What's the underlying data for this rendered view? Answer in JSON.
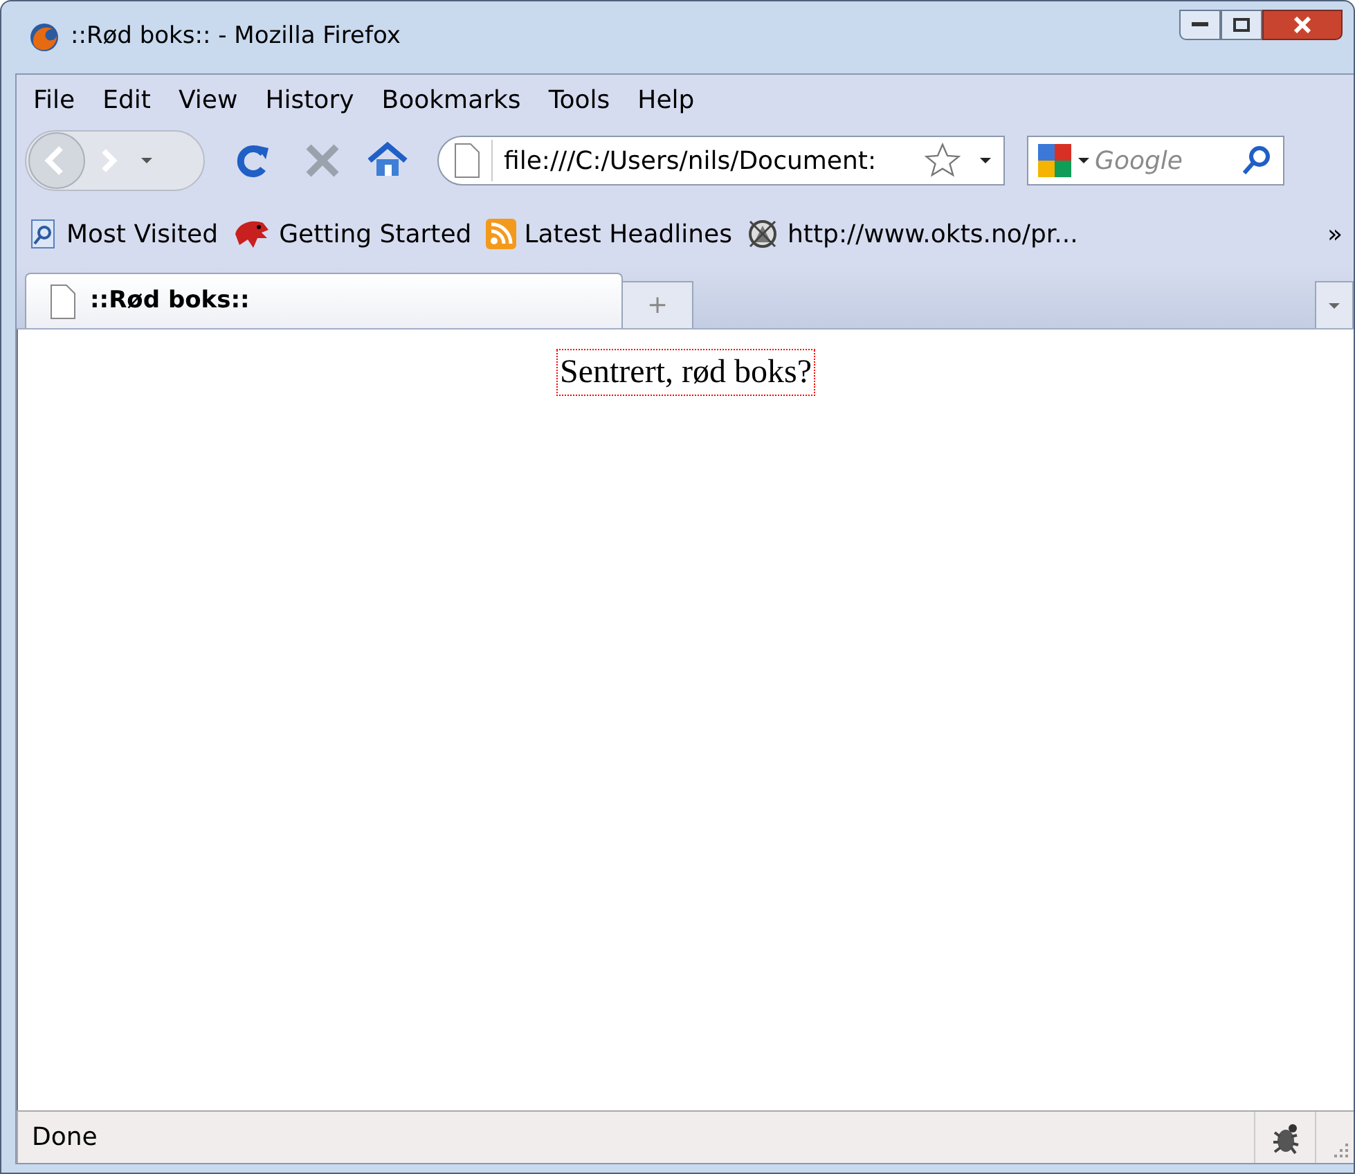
{
  "window": {
    "title": "::Rød boks:: - Mozilla Firefox"
  },
  "menu": [
    "File",
    "Edit",
    "View",
    "History",
    "Bookmarks",
    "Tools",
    "Help"
  ],
  "address": {
    "value": "file:///C:/Users/nils/Document:"
  },
  "search": {
    "placeholder": "Google"
  },
  "bookmarks": [
    {
      "label": "Most Visited",
      "kind": "search"
    },
    {
      "label": "Getting Started",
      "kind": "dragon"
    },
    {
      "label": "Latest Headlines",
      "kind": "rss"
    },
    {
      "label": "http://www.okts.no/pr...",
      "kind": "emblem"
    }
  ],
  "bookmarks_more": "»",
  "tabs": [
    {
      "label": "::Rød boks::",
      "selected": true
    }
  ],
  "new_tab": "+",
  "page": {
    "boxed_text": "Sentrert, rød boks?"
  },
  "status_bar": {
    "text": "Done"
  }
}
